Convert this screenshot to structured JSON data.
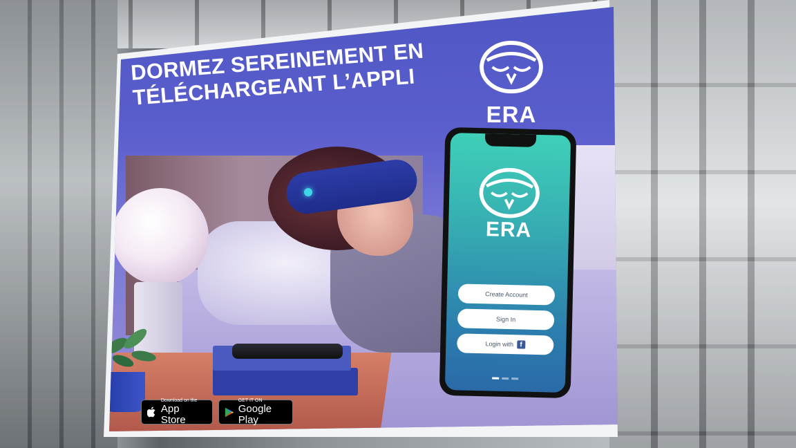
{
  "billboard": {
    "headline_line1": "DORMEZ SEREINEMENT EN",
    "headline_line2": "TÉLÉCHARGEANT L’APPLI",
    "brand_name": "ERA"
  },
  "phone_app": {
    "brand_name": "ERA",
    "create_account_label": "Create Account",
    "sign_in_label": "Sign In",
    "login_with_label": "Login with",
    "facebook_glyph": "f",
    "page_dots": 3,
    "active_dot": 1
  },
  "store_badges": {
    "app_store": {
      "small": "Download on the",
      "big": "App Store"
    },
    "google_play": {
      "small": "GET IT ON",
      "big": "Google Play"
    }
  },
  "colors": {
    "poster_blue": "#5a5ecd",
    "app_teal": "#3fd0b8",
    "headband_blue": "#1e2c8a",
    "headband_light": "#3fd4e8"
  }
}
